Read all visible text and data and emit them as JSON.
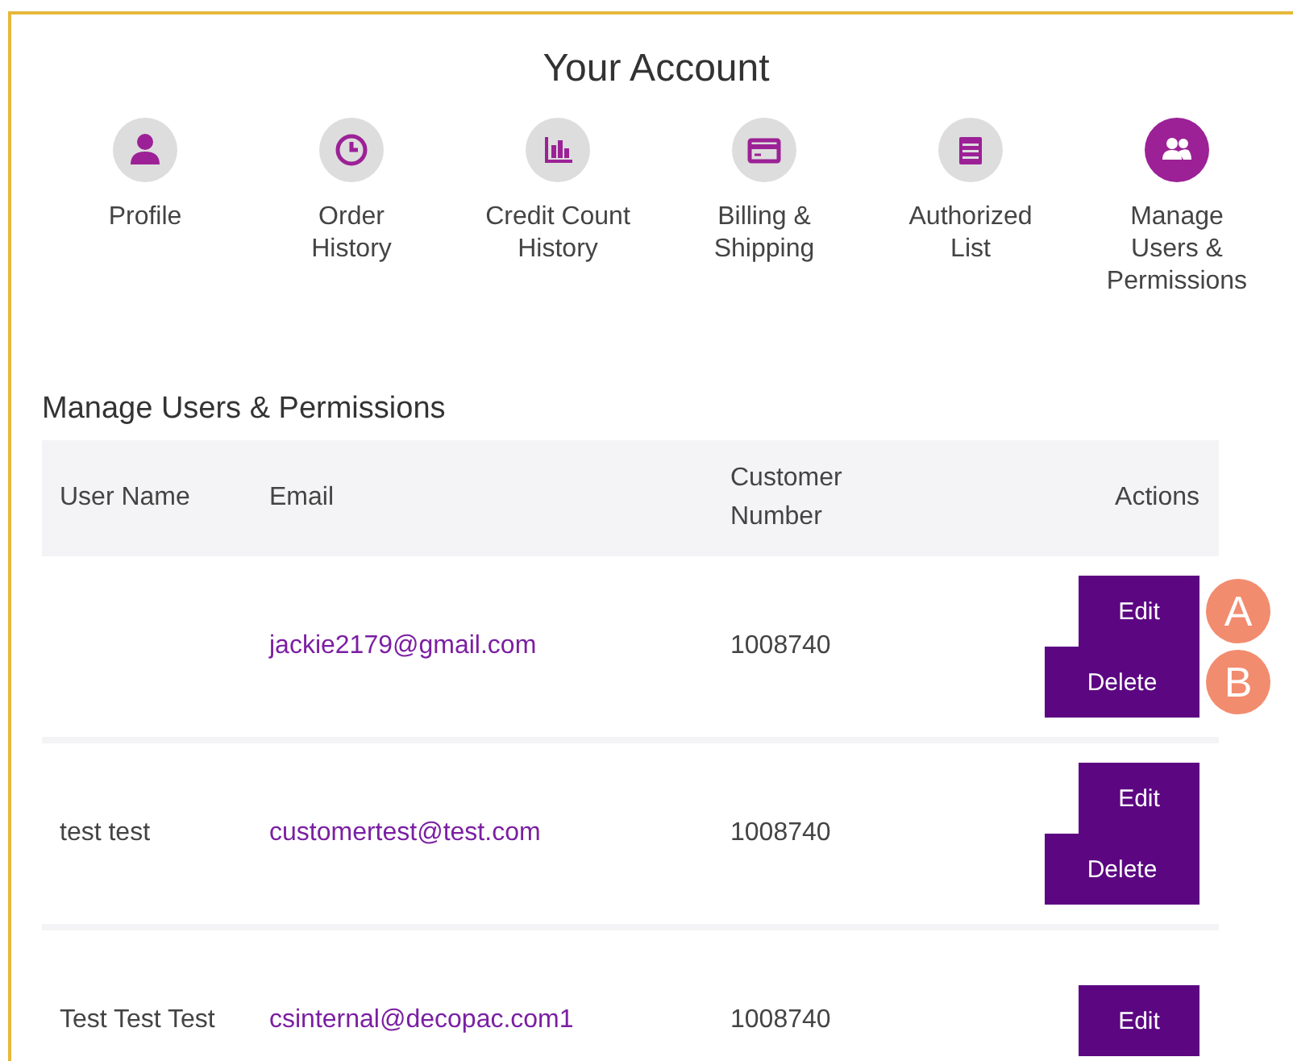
{
  "page_title": "Your Account",
  "nav": [
    {
      "label": "Profile",
      "selected": false
    },
    {
      "label": "Order History",
      "selected": false
    },
    {
      "label": "Credit Count History",
      "selected": false
    },
    {
      "label": "Billing & Shipping",
      "selected": false
    },
    {
      "label": "Authorized List",
      "selected": false
    },
    {
      "label": "Manage Users & Permissions",
      "selected": true
    }
  ],
  "section_title": "Manage Users & Permissions",
  "table": {
    "columns": [
      "User Name",
      "Email",
      "Customer Number",
      "Actions"
    ],
    "rows": [
      {
        "user_name": "",
        "email": "jackie2179@gmail.com",
        "customer_number": "1008740",
        "actions": [
          "Edit",
          "Delete"
        ],
        "callouts": [
          "A",
          "B"
        ]
      },
      {
        "user_name": "test test",
        "email": "customertest@test.com",
        "customer_number": "1008740",
        "actions": [
          "Edit",
          "Delete"
        ],
        "callouts": []
      },
      {
        "user_name": "Test Test Test",
        "email": "csinternal@decopac.com1",
        "customer_number": "1008740",
        "actions": [
          "Edit"
        ],
        "callouts": []
      }
    ]
  }
}
